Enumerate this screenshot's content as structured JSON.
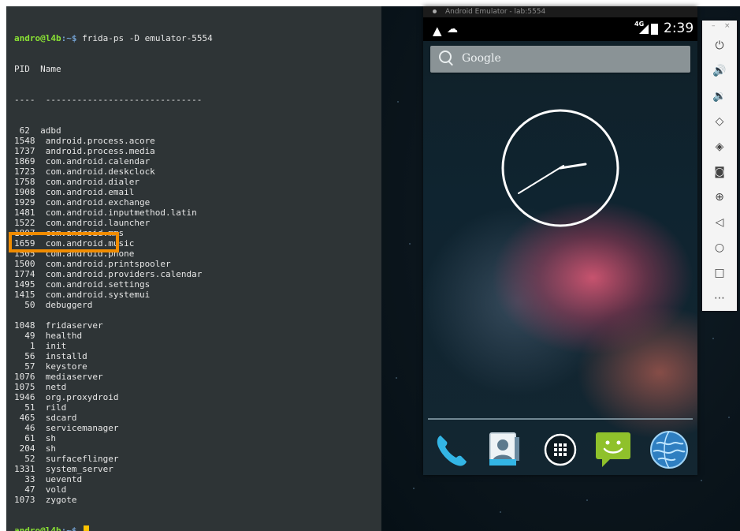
{
  "terminal": {
    "user": "andro",
    "host": "l4b",
    "path": ":~$",
    "command": " frida-ps -D emulator-5554",
    "header": "PID  Name",
    "separator": "----  ------------------------------",
    "processes": [
      " 62  adbd",
      "1548  android.process.acore",
      "1737  android.process.media",
      "1869  com.android.calendar",
      "1723  com.android.deskclock",
      "1758  com.android.dialer",
      "1908  com.android.email",
      "1929  com.android.exchange",
      "1481  com.android.inputmethod.latin",
      "1522  com.android.launcher",
      "1807  com.android.mms",
      "1659  com.android.music",
      "1505  com.android.phone",
      "1500  com.android.printspooler",
      "1774  com.android.providers.calendar",
      "1495  com.android.settings",
      "1415  com.android.systemui",
      "  50  debuggerd",
      "",
      "1048  fridaserver",
      "  49  healthd",
      "   1  init",
      "  56  installd",
      "  57  keystore",
      "1076  mediaserver",
      "1075  netd",
      "1946  org.proxydroid",
      "  51  rild",
      " 465  sdcard",
      "  46  servicemanager",
      "  61  sh",
      " 204  sh",
      "  52  surfaceflinger",
      "1331  system_server",
      "  33  ueventd",
      "  47  vold",
      "1073  zygote"
    ],
    "prompt2_path": ":~$"
  },
  "emulator": {
    "title": "Android Emulator - lab:5554",
    "status": {
      "network": "4G",
      "time": "2:39"
    },
    "search_label": "Google",
    "dock": [
      "phone-icon",
      "contacts-icon",
      "apps-drawer-icon",
      "messaging-icon",
      "browser-icon"
    ]
  },
  "controls": {
    "minimize": "–",
    "close": "×",
    "buttons": [
      "power-icon",
      "volume-up-icon",
      "volume-down-icon",
      "rotate-left-icon",
      "rotate-right-icon",
      "camera-icon",
      "zoom-icon",
      "back-icon",
      "home-icon",
      "overview-icon",
      "more-icon"
    ]
  },
  "colors": {
    "terminal_bg": "#2e3436",
    "prompt_user": "#8ae234",
    "prompt_host": "#729fcf",
    "highlight": "#f08c00",
    "cursor": "#fcc200"
  }
}
